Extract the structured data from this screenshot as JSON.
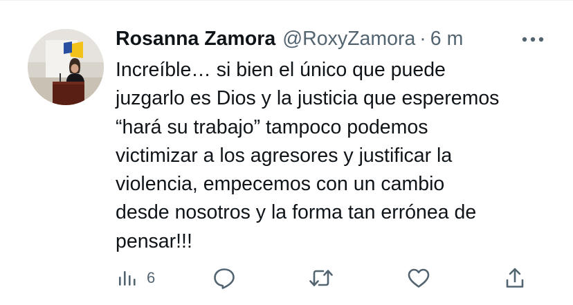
{
  "author": {
    "name": "Rosanna Zamora",
    "handle": "@RoxyZamora",
    "separator": "·",
    "time": "6 m"
  },
  "tweet": {
    "lines": [
      "Increíble… si bien el único que puede",
      "juzgarlo es Dios y la justicia que esperemos",
      "“hará su trabajo” tampoco podemos",
      "victimizar a los agresores y justificar la",
      "violencia, empecemos con un cambio",
      "desde nosotros y la forma tan errónea de",
      "pensar!!!"
    ]
  },
  "actions": {
    "views": "6"
  },
  "icons": {
    "more": "more-horizontal-icon",
    "views": "analytics-bar-icon",
    "reply": "reply-bubble-icon",
    "retweet": "retweet-icon",
    "like": "heart-icon",
    "share": "share-upload-icon"
  },
  "colors": {
    "text": "#0f1419",
    "secondary": "#536471",
    "icon": "#536471",
    "divider": "#eff3f4"
  }
}
